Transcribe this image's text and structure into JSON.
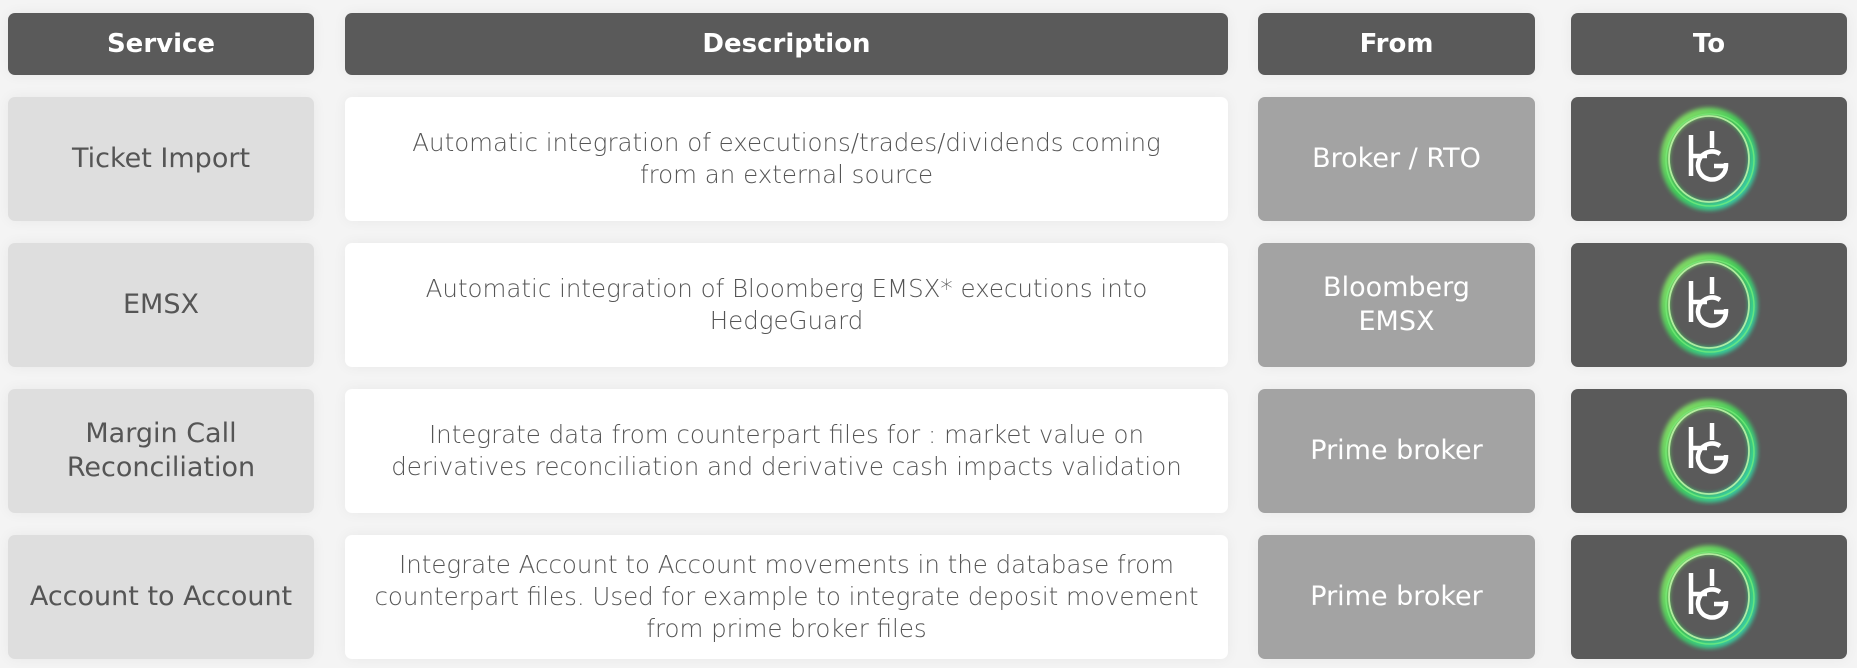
{
  "header": {
    "service": "Service",
    "description": "Description",
    "from": "From",
    "to": "To"
  },
  "rows": [
    {
      "service": "Ticket Import",
      "description": "Automatic integration of executions/trades/dividends coming from an external source",
      "from": "Broker / RTO",
      "to_icon": "hedgeguard-logo-icon",
      "to_text": "HG"
    },
    {
      "service": "EMSX",
      "description": "Automatic integration of Bloomberg EMSX* executions into HedgeGuard",
      "from": "Bloomberg EMSX",
      "to_icon": "hedgeguard-logo-icon",
      "to_text": "HG"
    },
    {
      "service": "Margin Call Reconciliation",
      "description": "Integrate data from counterpart files for : market value on derivatives reconciliation and derivative cash impacts validation",
      "from": "Prime broker",
      "to_icon": "hedgeguard-logo-icon",
      "to_text": "HG"
    },
    {
      "service": "Account to Account",
      "description": "Integrate Account to Account movements in the database from counterpart files. Used for example to integrate deposit movement from prime broker files",
      "from": "Prime broker",
      "to_icon": "hedgeguard-logo-icon",
      "to_text": "HG"
    }
  ],
  "colors": {
    "header_bg": "#5a5a5a",
    "service_bg": "#dedede",
    "description_bg": "#ffffff",
    "from_bg": "#a3a3a3",
    "to_bg": "#5a5a5a",
    "logo_ring_green": "#3ddc5a",
    "logo_ring_cyan": "#2de0c8"
  }
}
